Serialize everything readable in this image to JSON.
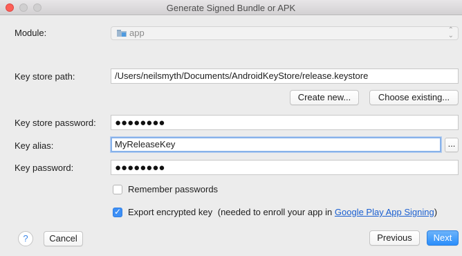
{
  "window": {
    "title": "Generate Signed Bundle or APK"
  },
  "module": {
    "label": "Module:",
    "value": "app",
    "icon": "folder-icon"
  },
  "keystore_path": {
    "label": "Key store path:",
    "value": "/Users/neilsmyth/Documents/AndroidKeyStore/release.keystore",
    "create_new": "Create new...",
    "choose_existing": "Choose existing..."
  },
  "keystore_password": {
    "label": "Key store password:",
    "value": "●●●●●●●●"
  },
  "key_alias": {
    "label": "Key alias:",
    "value": "MyReleaseKey",
    "browse": "..."
  },
  "key_password": {
    "label": "Key password:",
    "value": "●●●●●●●●"
  },
  "remember": {
    "label": "Remember passwords",
    "checked": false
  },
  "export": {
    "label": "Export encrypted key",
    "note": "(needed to enroll your app in",
    "link": "Google Play App Signing",
    "suffix": ")",
    "checked": true
  },
  "footer": {
    "help": "?",
    "cancel": "Cancel",
    "previous": "Previous",
    "next": "Next"
  },
  "colors": {
    "accent": "#2a8efb",
    "link": "#1a5fd0",
    "close": "#fc5f57"
  }
}
